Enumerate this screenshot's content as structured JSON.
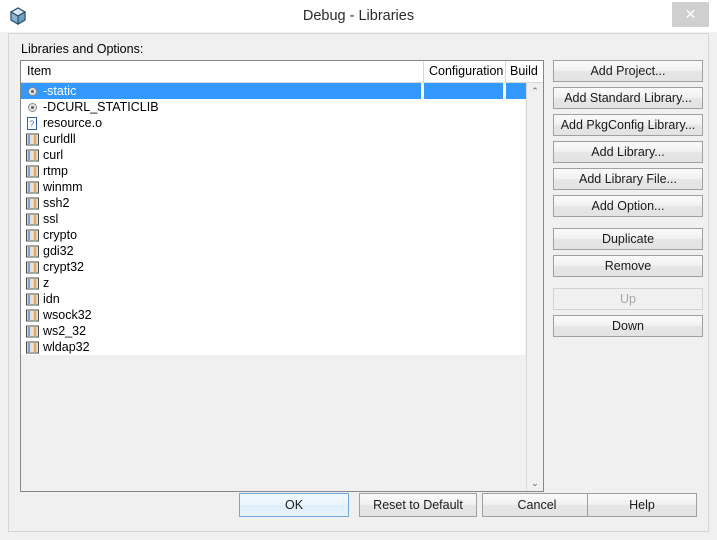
{
  "window": {
    "title": "Debug - Libraries",
    "icon": "cube-icon",
    "close_label": "✕"
  },
  "content": {
    "section_label": "Libraries and Options:"
  },
  "list": {
    "columns": [
      "Item",
      "Configuration",
      "Build"
    ],
    "rows": [
      {
        "label": "-static",
        "icon": "option-icon",
        "selected": true,
        "configuration": "",
        "build": ""
      },
      {
        "label": "-DCURL_STATICLIB",
        "icon": "option-icon",
        "selected": false,
        "configuration": "",
        "build": ""
      },
      {
        "label": "resource.o",
        "icon": "file-icon",
        "selected": false,
        "configuration": "",
        "build": ""
      },
      {
        "label": "curldll",
        "icon": "library-icon",
        "selected": false,
        "configuration": "",
        "build": ""
      },
      {
        "label": "curl",
        "icon": "library-icon",
        "selected": false,
        "configuration": "",
        "build": ""
      },
      {
        "label": "rtmp",
        "icon": "library-icon",
        "selected": false,
        "configuration": "",
        "build": ""
      },
      {
        "label": "winmm",
        "icon": "library-icon",
        "selected": false,
        "configuration": "",
        "build": ""
      },
      {
        "label": "ssh2",
        "icon": "library-icon",
        "selected": false,
        "configuration": "",
        "build": ""
      },
      {
        "label": "ssl",
        "icon": "library-icon",
        "selected": false,
        "configuration": "",
        "build": ""
      },
      {
        "label": "crypto",
        "icon": "library-icon",
        "selected": false,
        "configuration": "",
        "build": ""
      },
      {
        "label": "gdi32",
        "icon": "library-icon",
        "selected": false,
        "configuration": "",
        "build": ""
      },
      {
        "label": "crypt32",
        "icon": "library-icon",
        "selected": false,
        "configuration": "",
        "build": ""
      },
      {
        "label": "z",
        "icon": "library-icon",
        "selected": false,
        "configuration": "",
        "build": ""
      },
      {
        "label": "idn",
        "icon": "library-icon",
        "selected": false,
        "configuration": "",
        "build": ""
      },
      {
        "label": "wsock32",
        "icon": "library-icon",
        "selected": false,
        "configuration": "",
        "build": ""
      },
      {
        "label": "ws2_32",
        "icon": "library-icon",
        "selected": false,
        "configuration": "",
        "build": ""
      },
      {
        "label": "wldap32",
        "icon": "library-icon",
        "selected": false,
        "configuration": "",
        "build": ""
      }
    ],
    "scrollbar": {
      "up_arrow": "⌃",
      "down_arrow": "⌄"
    }
  },
  "side_buttons": [
    {
      "label": "Add Project...",
      "name": "add-project-button",
      "disabled": false,
      "gap": false
    },
    {
      "label": "Add Standard Library...",
      "name": "add-standard-library-button",
      "disabled": false,
      "gap": false
    },
    {
      "label": "Add PkgConfig Library...",
      "name": "add-pkgconfig-library-button",
      "disabled": false,
      "gap": false
    },
    {
      "label": "Add Library...",
      "name": "add-library-button",
      "disabled": false,
      "gap": false
    },
    {
      "label": "Add Library File...",
      "name": "add-library-file-button",
      "disabled": false,
      "gap": false
    },
    {
      "label": "Add Option...",
      "name": "add-option-button",
      "disabled": false,
      "gap": false
    },
    {
      "label": "Duplicate",
      "name": "duplicate-button",
      "disabled": false,
      "gap": true
    },
    {
      "label": "Remove",
      "name": "remove-button",
      "disabled": false,
      "gap": false
    },
    {
      "label": "Up",
      "name": "move-up-button",
      "disabled": true,
      "gap": true
    },
    {
      "label": "Down",
      "name": "move-down-button",
      "disabled": false,
      "gap": false
    }
  ],
  "bottom_buttons": {
    "ok": "OK",
    "reset": "Reset to Default",
    "cancel": "Cancel",
    "help": "Help"
  },
  "colors": {
    "selection": "#3399ff",
    "dialog_bg": "#f0f0f0",
    "list_bg": "#ffffff",
    "focus_border": "#6fa8dc"
  }
}
